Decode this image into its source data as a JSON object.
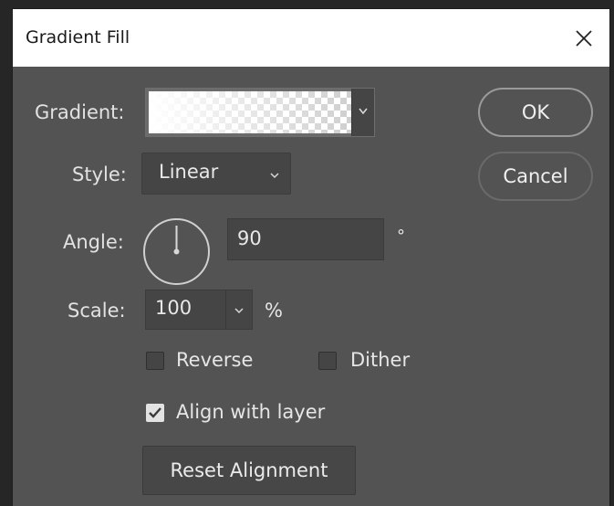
{
  "dialog": {
    "title": "Gradient Fill",
    "close_icon": "close-x-icon"
  },
  "gradient": {
    "label": "Gradient:",
    "swatch": "white-to-transparent"
  },
  "style": {
    "label": "Style:",
    "value": "Linear"
  },
  "angle": {
    "label": "Angle:",
    "value": "90",
    "unit": "°"
  },
  "scale": {
    "label": "Scale:",
    "value": "100",
    "unit": "%"
  },
  "options": {
    "reverse": {
      "label": "Reverse",
      "checked": false
    },
    "dither": {
      "label": "Dither",
      "checked": false
    },
    "align_with_layer": {
      "label": "Align with layer",
      "checked": true
    }
  },
  "buttons": {
    "ok": "OK",
    "cancel": "Cancel",
    "reset_alignment": "Reset Alignment"
  },
  "colors": {
    "panel": "#535353",
    "field": "#454545",
    "text": "#e2e2e2",
    "titlebar": "#ffffff"
  }
}
